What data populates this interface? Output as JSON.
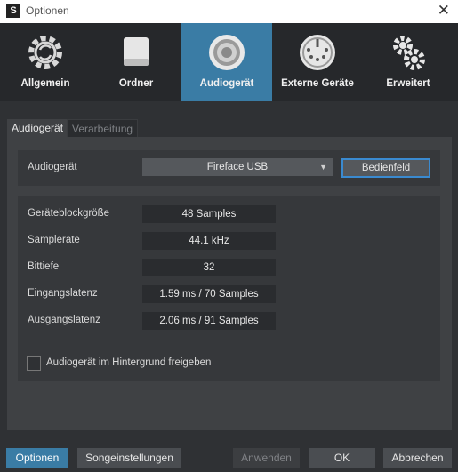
{
  "window": {
    "title": "Optionen",
    "app_icon": "studio-one-icon",
    "close_icon": "close-icon"
  },
  "toolbar": {
    "items": [
      {
        "label": "Allgemein",
        "icon": "gear-icon",
        "active": false
      },
      {
        "label": "Ordner",
        "icon": "drive-icon",
        "active": false
      },
      {
        "label": "Audiogerät",
        "icon": "speaker-icon",
        "active": true
      },
      {
        "label": "Externe Geräte",
        "icon": "midi-port-icon",
        "active": false
      },
      {
        "label": "Erweitert",
        "icon": "gears-icon",
        "active": false
      }
    ]
  },
  "tabs": [
    {
      "label": "Audiogerät",
      "active": true
    },
    {
      "label": "Verarbeitung",
      "active": false
    }
  ],
  "device": {
    "label": "Audiogerät",
    "selected": "Fireface USB",
    "control_panel_button": "Bedienfeld"
  },
  "params": [
    {
      "label": "Geräteblockgröße",
      "value": "48 Samples"
    },
    {
      "label": "Samplerate",
      "value": "44.1 kHz"
    },
    {
      "label": "Bittiefe",
      "value": "32"
    },
    {
      "label": "Eingangslatenz",
      "value": "1.59 ms / 70 Samples"
    },
    {
      "label": "Ausgangslatenz",
      "value": "2.06 ms / 91 Samples"
    }
  ],
  "background_release": {
    "label": "Audiogerät im Hintergrund freigeben",
    "checked": false
  },
  "footer": {
    "options": "Optionen",
    "song_settings": "Songeinstellungen",
    "apply": "Anwenden",
    "ok": "OK",
    "cancel": "Abbrechen"
  },
  "colors": {
    "accent": "#3a7ca5",
    "focus_border": "#3a8ad0",
    "background": "#2f3134"
  }
}
